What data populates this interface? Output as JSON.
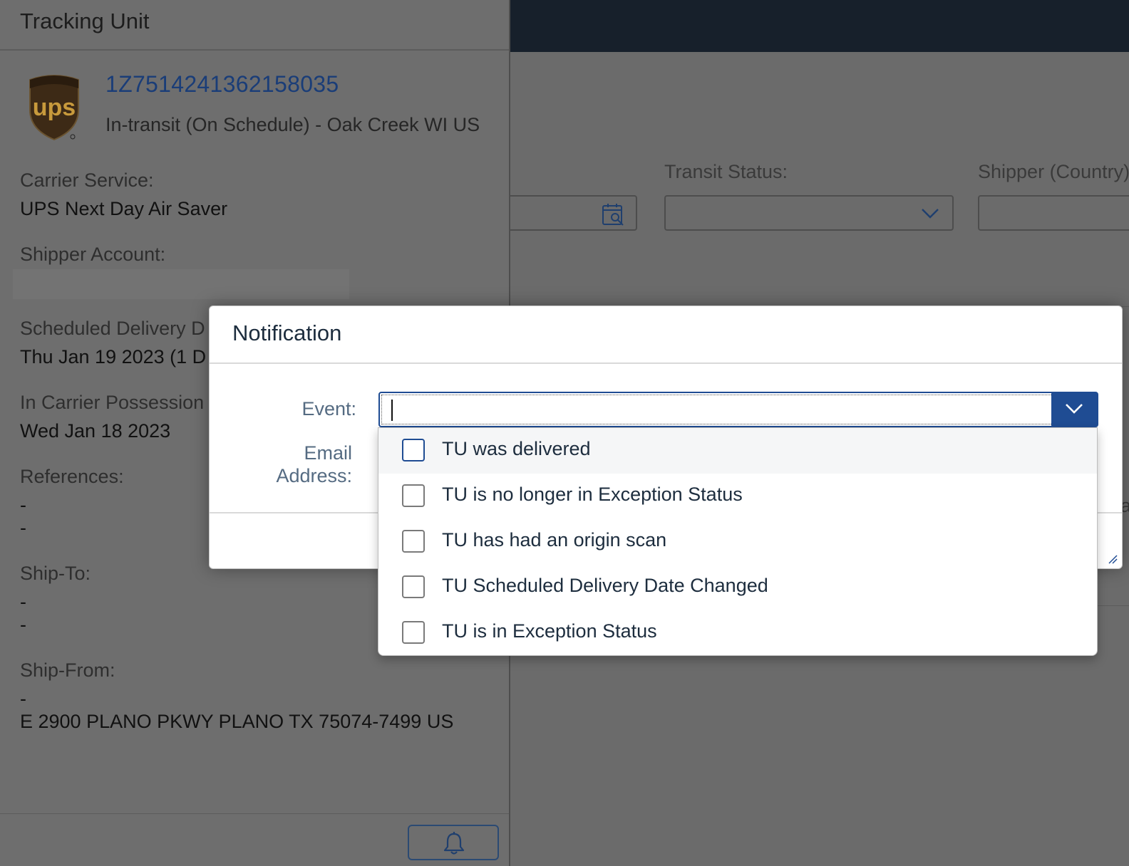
{
  "main": {
    "filters": [
      {
        "label": "Transit Status:",
        "value": ""
      },
      {
        "label": "Shipper (Country)",
        "value": ""
      }
    ],
    "peek_char": "a"
  },
  "side_panel": {
    "title": "Tracking Unit",
    "tracking_number": "1Z7514241362158035",
    "status": "In-transit (On Schedule) - Oak Creek WI US",
    "fields": [
      {
        "label": "Carrier Service:",
        "values": [
          "UPS Next Day Air Saver"
        ]
      },
      {
        "label": "Shipper Account:",
        "values": []
      },
      {
        "label": "Scheduled Delivery D",
        "values": [
          "Thu Jan 19 2023 (1 D"
        ]
      },
      {
        "label": "In Carrier Possession",
        "values": [
          "Wed Jan 18 2023"
        ]
      },
      {
        "label": "References:",
        "values": [
          "-",
          "-"
        ]
      },
      {
        "label": "Ship-To:",
        "values": [
          "-",
          "-"
        ]
      },
      {
        "label": "Ship-From:",
        "values": [
          "-",
          "E 2900 PLANO PKWY PLANO TX 75074-7499 US"
        ]
      }
    ],
    "logo_text": "ups",
    "footer_icon": "bell-icon"
  },
  "dialog": {
    "title": "Notification",
    "event_label": "Event:",
    "email_label_line1": "Email",
    "email_label_line2": "Address:",
    "event_value": ""
  },
  "dropdown": {
    "options": [
      "TU was delivered",
      "TU is no longer in Exception Status",
      "TU has had an origin scan",
      "TU Scheduled Delivery Date Changed",
      "TU is in Exception Status"
    ]
  },
  "colors": {
    "accent": "#1f4c93",
    "link": "#1a3d78",
    "shell": "#17202b"
  }
}
